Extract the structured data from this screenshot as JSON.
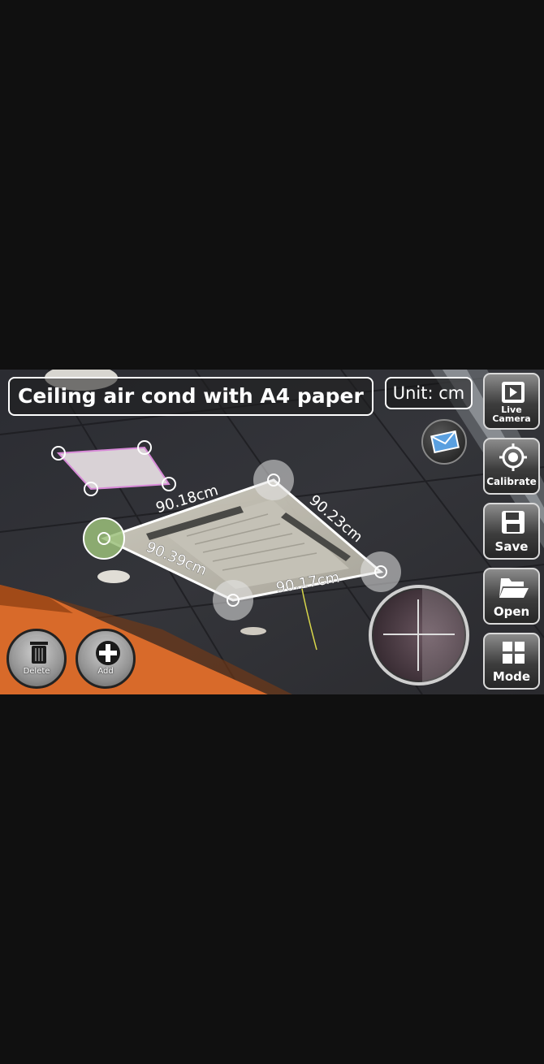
{
  "title": "Ceiling air cond with A4 paper",
  "unit_label": "Unit: cm",
  "measurements": [
    "90.18cm",
    "90.23cm",
    "90.39cm",
    "90.17cm"
  ],
  "side_buttons": [
    {
      "id": "live",
      "label": "Live Camera",
      "icon": "video-camera-icon"
    },
    {
      "id": "calibrate",
      "label": "Calibrate",
      "icon": "crosshair-icon"
    },
    {
      "id": "save",
      "label": "Save",
      "icon": "floppy-disk-icon"
    },
    {
      "id": "open",
      "label": "Open",
      "icon": "folder-open-icon"
    },
    {
      "id": "mode",
      "label": "Mode",
      "icon": "grid-icon"
    }
  ],
  "bottom_buttons": {
    "delete": "Delete",
    "add": "Add"
  },
  "colors": {
    "paper_outline": "#d88ad8",
    "selected_handle": "#9bc07a",
    "accent_white": "#ffffff"
  }
}
